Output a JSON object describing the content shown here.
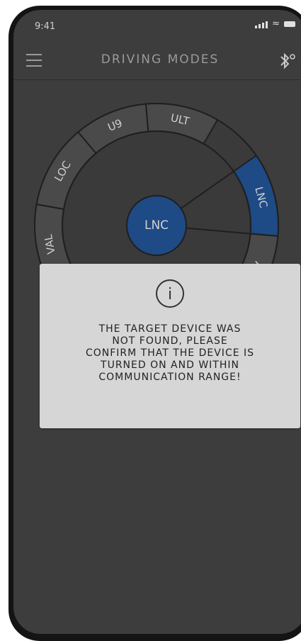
{
  "status_bar": {
    "time": "9:41"
  },
  "header": {
    "title": "DRIVING MODES",
    "menu_icon": "menu-icon",
    "bluetooth_icon": "bluetooth-icon"
  },
  "mode_wheel": {
    "segments": [
      "LNC",
      "APT",
      "VAL",
      "LOC",
      "U9",
      "ULT"
    ],
    "selected": "LNC",
    "center_label": "LNC",
    "accent_color": "#1e4a86"
  },
  "dialog": {
    "icon": "info-icon",
    "icon_glyph": "i",
    "message_lines": [
      "THE TARGET DEVICE WAS",
      "NOT FOUND, PLEASE",
      "CONFIRM THAT THE DEVICE IS",
      "TURNED ON AND WITHIN",
      "COMMUNICATION RANGE!"
    ]
  }
}
